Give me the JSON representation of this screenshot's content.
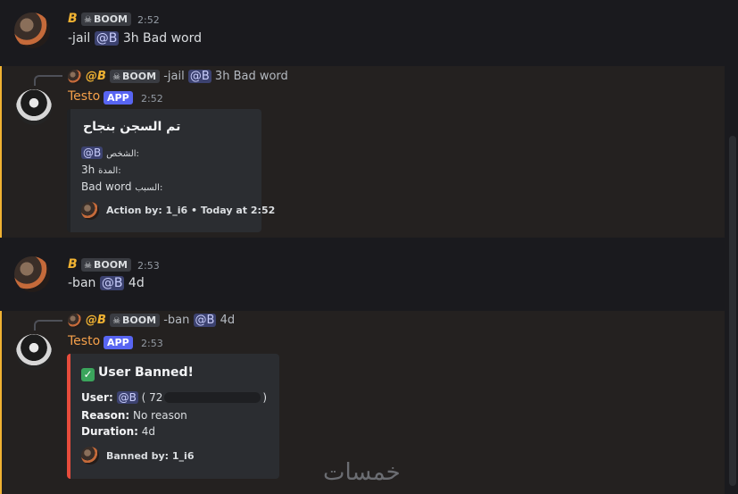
{
  "messages": [
    {
      "user": "B",
      "tag": "BOOM",
      "time": "2:52",
      "command": "-jail",
      "mention": "@B",
      "rest": "3h Bad word"
    },
    {
      "user": "B",
      "tag": "BOOM",
      "time": "2:53",
      "command": "-ban",
      "mention": "@B",
      "rest": "4d"
    }
  ],
  "replies": [
    {
      "user": "@B",
      "tag": "BOOM",
      "command": "-jail",
      "mention": "@B",
      "rest": "3h Bad word"
    },
    {
      "user": "@B",
      "tag": "BOOM",
      "command": "-ban",
      "mention": "@B",
      "rest": "4d"
    }
  ],
  "bot": {
    "name": "Testo",
    "badge": "APP",
    "time1": "2:52",
    "time2": "2:53"
  },
  "jail_embed": {
    "title": "تم السجن بنجاح",
    "person_label": "الشخص:",
    "person_value": "@B",
    "duration_label": "المدة:",
    "duration_value": "3h",
    "reason_label": "السبب:",
    "reason_value": "Bad word",
    "footer": "Action by: 1_i6 • Today at 2:52"
  },
  "ban_embed": {
    "title": "User Banned!",
    "user_label": "User:",
    "user_mention": "@B",
    "user_id_prefix": "( 72",
    "user_id_suffix": ")",
    "reason_label": "Reason:",
    "reason_value": "No reason",
    "duration_label": "Duration:",
    "duration_value": "4d",
    "footer": "Banned by: 1_i6"
  },
  "watermark": "خمسات",
  "colors": {
    "accent_highlight": "#f0b232",
    "mention_bg": "#3c4270",
    "app_badge": "#5865f2",
    "ban_border": "#e74c3c"
  }
}
